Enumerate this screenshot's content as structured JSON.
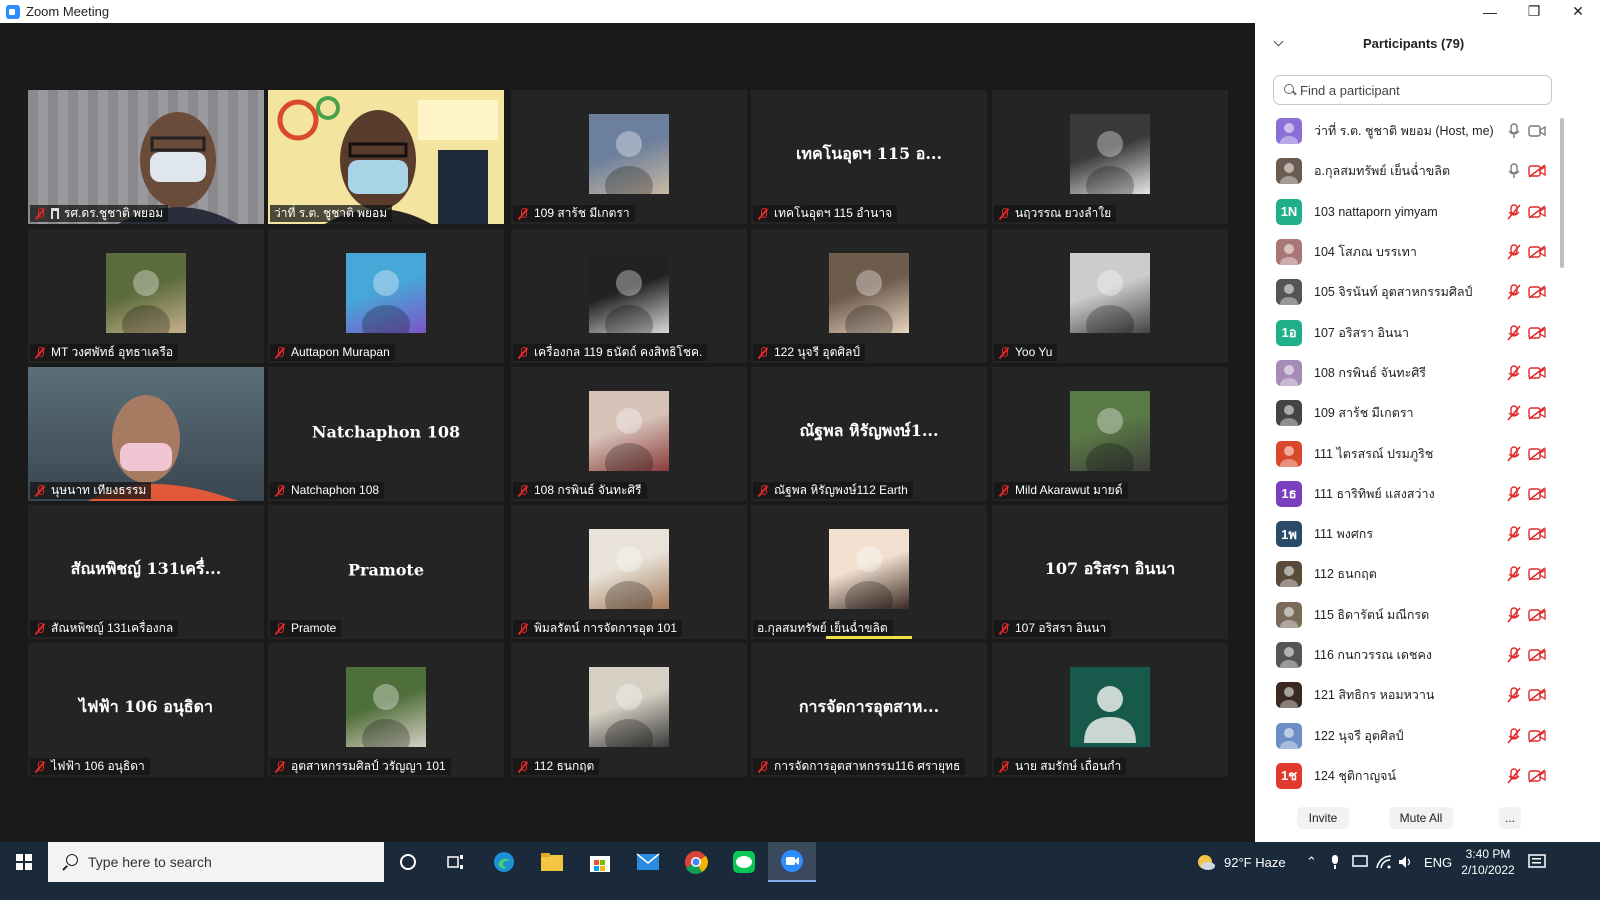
{
  "window": {
    "title": "Zoom Meeting"
  },
  "tiles": [
    {
      "name": "รศ.ดร.ชูชาติ  พยอม",
      "kind": "camera",
      "muted": true,
      "pinned": true
    },
    {
      "name": "ว่าที่ ร.ต. ชูชาติ พยอม",
      "kind": "camera",
      "muted": false,
      "active": true
    },
    {
      "name": "109 สาร้ช มีเกตรา",
      "kind": "photo",
      "muted": true
    },
    {
      "name": "เทคโนอุตฯ 115  อำนาจ",
      "kind": "text",
      "label": "เทคโนอุตฯ 115  อ...",
      "muted": true
    },
    {
      "name": "นฤวรรณ ยวงลำใย",
      "kind": "photo",
      "muted": true
    },
    {
      "name": "MT วงศพัทธ์ อุทธาเครือ",
      "kind": "photo",
      "muted": true
    },
    {
      "name": "Auttapon Murapan",
      "kind": "photo",
      "muted": true
    },
    {
      "name": "เครื่องกล 119 ธนัตถ์ คงสิทธิโชค.",
      "kind": "photo",
      "muted": true
    },
    {
      "name": "122 นุจรี อุตศิลป์",
      "kind": "photo",
      "muted": true
    },
    {
      "name": "Yoo Yu",
      "kind": "photo",
      "muted": true
    },
    {
      "name": "นุษนาท  เทียงธรรม",
      "kind": "camera",
      "muted": true
    },
    {
      "name": "Natchaphon 108",
      "kind": "text",
      "label": "Natchaphon 108",
      "muted": true
    },
    {
      "name": "108 กรพินธ์ จันทะศิรี",
      "kind": "photo",
      "muted": true
    },
    {
      "name": "ณัฐพล หิรัญพงษ์112 Earth",
      "kind": "text",
      "label": "ณัฐพล หิรัญพงษ์1...",
      "muted": true
    },
    {
      "name": "Mild Akarawut มายด์",
      "kind": "photo",
      "muted": true
    },
    {
      "name": "สัณหพิชญ์ 131เครื่องกล",
      "kind": "text",
      "label": "สัณหพิชญ์ 131เครื่...",
      "muted": true
    },
    {
      "name": "Pramote",
      "kind": "text",
      "label": "Pramote",
      "muted": true
    },
    {
      "name": "พิมลรัตน์ การจัดการอุต 101",
      "kind": "photo",
      "muted": true
    },
    {
      "name": "อ.กุลสมทรัพย์ เย็นฉ่ำขลิต",
      "kind": "photo",
      "muted": false,
      "speaking": true
    },
    {
      "name": "107 อริสรา อินนา",
      "kind": "text",
      "label": "107 อริสรา อินนา",
      "muted": true
    },
    {
      "name": "ไฟฟ้า 106 อนุธิดา",
      "kind": "text",
      "label": "ไฟฟ้า 106 อนุธิดา",
      "muted": true
    },
    {
      "name": "อุตสาหกรรมศิลป์ วรัญญา 101",
      "kind": "photo",
      "muted": true
    },
    {
      "name": "112 ธนกฤต",
      "kind": "photo",
      "muted": true
    },
    {
      "name": "การจัดการอุตสาหกรรม116 ศรายุทธ",
      "kind": "text",
      "label": "การจัดการอุตสาห...",
      "muted": true
    },
    {
      "name": "นาย สมรักษ์ เถื่อนกำ",
      "kind": "avatar",
      "muted": true
    }
  ],
  "panel": {
    "title": "Participants (79)",
    "search_placeholder": "Find a participant",
    "participants": [
      {
        "name": "ว่าที่ ร.ต. ชูชาติ พยอม (Host, me)",
        "avatar": "photo",
        "color": "#8a6fd6",
        "mic": "on",
        "cam": "on"
      },
      {
        "name": "อ.กุลสมทรัพย์ เย็นฉ่ำขลิต",
        "avatar": "photo",
        "color": "#6a5a50",
        "mic": "on",
        "cam": "off"
      },
      {
        "name": "103 nattaporn yimyam",
        "avatar": "1N",
        "color": "#1fb089",
        "mic": "off",
        "cam": "off"
      },
      {
        "name": "104 โสภณ บรรเทา",
        "avatar": "photo",
        "color": "#a77",
        "mic": "off",
        "cam": "off"
      },
      {
        "name": "105 จิรนันท์ อุตสาหกรรมศิลป์",
        "avatar": "photo",
        "color": "#555",
        "mic": "off",
        "cam": "off"
      },
      {
        "name": "107 อริสรา อินนา",
        "avatar": "1อ",
        "color": "#1fb089",
        "mic": "off",
        "cam": "off"
      },
      {
        "name": "108 กรพินธ์ จันทะศิรี",
        "avatar": "photo",
        "color": "#a58bb5",
        "mic": "off",
        "cam": "off"
      },
      {
        "name": "109 สาร้ช มีเกตรา",
        "avatar": "photo",
        "color": "#444",
        "mic": "off",
        "cam": "off"
      },
      {
        "name": "111 ไตรสรณ์ ปรมภูริช",
        "avatar": "photo",
        "color": "#d9482b",
        "mic": "off",
        "cam": "off"
      },
      {
        "name": "111 ธาริทิพย์ แสงสว่าง",
        "avatar": "1ธ",
        "color": "#7a3fbf",
        "mic": "off",
        "cam": "off"
      },
      {
        "name": "111 พงศกร",
        "avatar": "1พ",
        "color": "#2a4a6a",
        "mic": "off",
        "cam": "off"
      },
      {
        "name": "112 ธนกฤต",
        "avatar": "photo",
        "color": "#5a4a3a",
        "mic": "off",
        "cam": "off"
      },
      {
        "name": "115 ธิดารัตน์ มณีกรด",
        "avatar": "photo",
        "color": "#7a6a5a",
        "mic": "off",
        "cam": "off"
      },
      {
        "name": "116 กนกวรรณ เดชคง",
        "avatar": "photo",
        "color": "#555",
        "mic": "off",
        "cam": "off"
      },
      {
        "name": "121 สิทธิกร หอมหวาน",
        "avatar": "photo",
        "color": "#3a2a22",
        "mic": "off",
        "cam": "off"
      },
      {
        "name": "122 นุจรี อุตศิลป์",
        "avatar": "photo",
        "color": "#6b8fc4",
        "mic": "off",
        "cam": "off"
      },
      {
        "name": "124 ชุติกาญจน์",
        "avatar": "1ช",
        "color": "#e03a2f",
        "mic": "off",
        "cam": "off"
      }
    ],
    "footer": {
      "invite": "Invite",
      "mute_all": "Mute All",
      "more": "..."
    }
  },
  "taskbar": {
    "search_placeholder": "Type here to search",
    "weather": "92°F  Haze",
    "language": "ENG",
    "time": "3:40 PM",
    "date": "2/10/2022"
  }
}
